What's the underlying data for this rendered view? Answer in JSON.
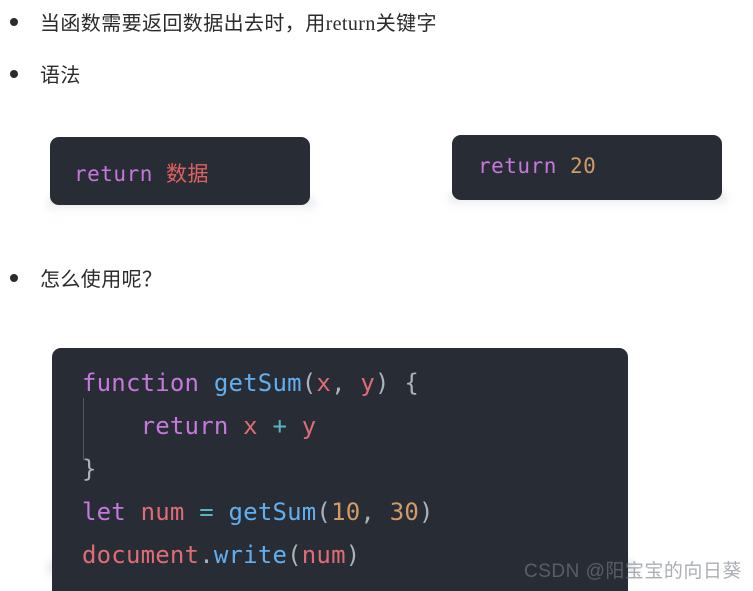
{
  "page": {
    "background_color": "#ffffff",
    "watermark": "CSDN @阳宝宝的向日葵"
  },
  "bullets": [
    {
      "text": "当函数需要返回数据出去时，用return关键字"
    },
    {
      "text": "语法"
    },
    {
      "text": "怎么使用呢？"
    }
  ],
  "code_blocks": [
    {
      "name": "syntax-return-data",
      "background_color": "#282c34",
      "lines": [
        {
          "tokens": [
            {
              "text": "return ",
              "color": "#c678dd",
              "kind": "keyword"
            },
            {
              "text": "数据",
              "color": "#e06060",
              "kind": "placeholder"
            }
          ]
        }
      ]
    },
    {
      "name": "example-return-20",
      "background_color": "#282c34",
      "lines": [
        {
          "tokens": [
            {
              "text": "return ",
              "color": "#c678dd",
              "kind": "keyword"
            },
            {
              "text": "20",
              "color": "#d19a66",
              "kind": "number"
            }
          ]
        }
      ]
    },
    {
      "name": "example-getsum",
      "background_color": "#282c34",
      "lines": [
        {
          "tokens": [
            {
              "text": "function ",
              "color": "#c678dd",
              "kind": "keyword"
            },
            {
              "text": "getSum",
              "color": "#61afef",
              "kind": "function"
            },
            {
              "text": "(",
              "color": "#abb2bf",
              "kind": "punct"
            },
            {
              "text": "x",
              "color": "#e06c75",
              "kind": "variable"
            },
            {
              "text": ", ",
              "color": "#abb2bf",
              "kind": "punct"
            },
            {
              "text": "y",
              "color": "#e06c75",
              "kind": "variable"
            },
            {
              "text": ") {",
              "color": "#abb2bf",
              "kind": "punct"
            }
          ]
        },
        {
          "tokens": [
            {
              "text": "    ",
              "color": "#abb2bf",
              "kind": "indent"
            },
            {
              "text": "return ",
              "color": "#c678dd",
              "kind": "keyword"
            },
            {
              "text": "x",
              "color": "#e06c75",
              "kind": "variable"
            },
            {
              "text": " + ",
              "color": "#56b6c2",
              "kind": "operator"
            },
            {
              "text": "y",
              "color": "#e06c75",
              "kind": "variable"
            }
          ]
        },
        {
          "tokens": [
            {
              "text": "}",
              "color": "#abb2bf",
              "kind": "punct"
            }
          ]
        },
        {
          "tokens": [
            {
              "text": "let ",
              "color": "#c678dd",
              "kind": "keyword"
            },
            {
              "text": "num",
              "color": "#e06c75",
              "kind": "variable"
            },
            {
              "text": " = ",
              "color": "#56b6c2",
              "kind": "operator"
            },
            {
              "text": "getSum",
              "color": "#61afef",
              "kind": "function"
            },
            {
              "text": "(",
              "color": "#abb2bf",
              "kind": "punct"
            },
            {
              "text": "10",
              "color": "#d19a66",
              "kind": "number"
            },
            {
              "text": ", ",
              "color": "#abb2bf",
              "kind": "punct"
            },
            {
              "text": "30",
              "color": "#d19a66",
              "kind": "number"
            },
            {
              "text": ")",
              "color": "#abb2bf",
              "kind": "punct"
            }
          ]
        },
        {
          "tokens": [
            {
              "text": "document",
              "color": "#e06c75",
              "kind": "variable"
            },
            {
              "text": ".",
              "color": "#abb2bf",
              "kind": "punct"
            },
            {
              "text": "write",
              "color": "#61afef",
              "kind": "function"
            },
            {
              "text": "(",
              "color": "#abb2bf",
              "kind": "punct"
            },
            {
              "text": "num",
              "color": "#e06c75",
              "kind": "variable"
            },
            {
              "text": ")",
              "color": "#abb2bf",
              "kind": "punct"
            }
          ]
        }
      ]
    }
  ]
}
